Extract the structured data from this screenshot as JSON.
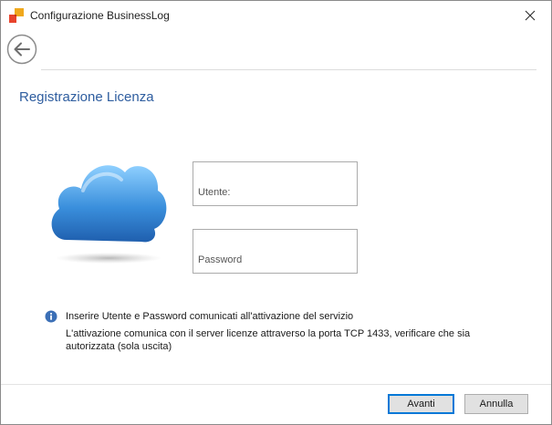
{
  "window": {
    "title": "Configurazione BusinessLog"
  },
  "icons": {
    "app": "app-logo-icon",
    "close": "close-icon",
    "back": "back-arrow-icon",
    "cloud": "cloud-icon",
    "info": "info-icon"
  },
  "main": {
    "section_title": "Registrazione Licenza",
    "username": {
      "label": "Utente:",
      "value": ""
    },
    "password": {
      "label": "Password",
      "value": ""
    },
    "info_line1": "Inserire Utente e Password comunicati all'attivazione del servizio",
    "info_line2": "L'attivazione comunica con il server licenze attraverso la porta TCP 1433, verificare che sia autorizzata (sola uscita)"
  },
  "footer": {
    "next_label": "Avanti",
    "cancel_label": "Annulla"
  },
  "colors": {
    "accent": "#0078d7",
    "title_blue": "#2e5d9f",
    "cloud": "#3a8fdc"
  }
}
